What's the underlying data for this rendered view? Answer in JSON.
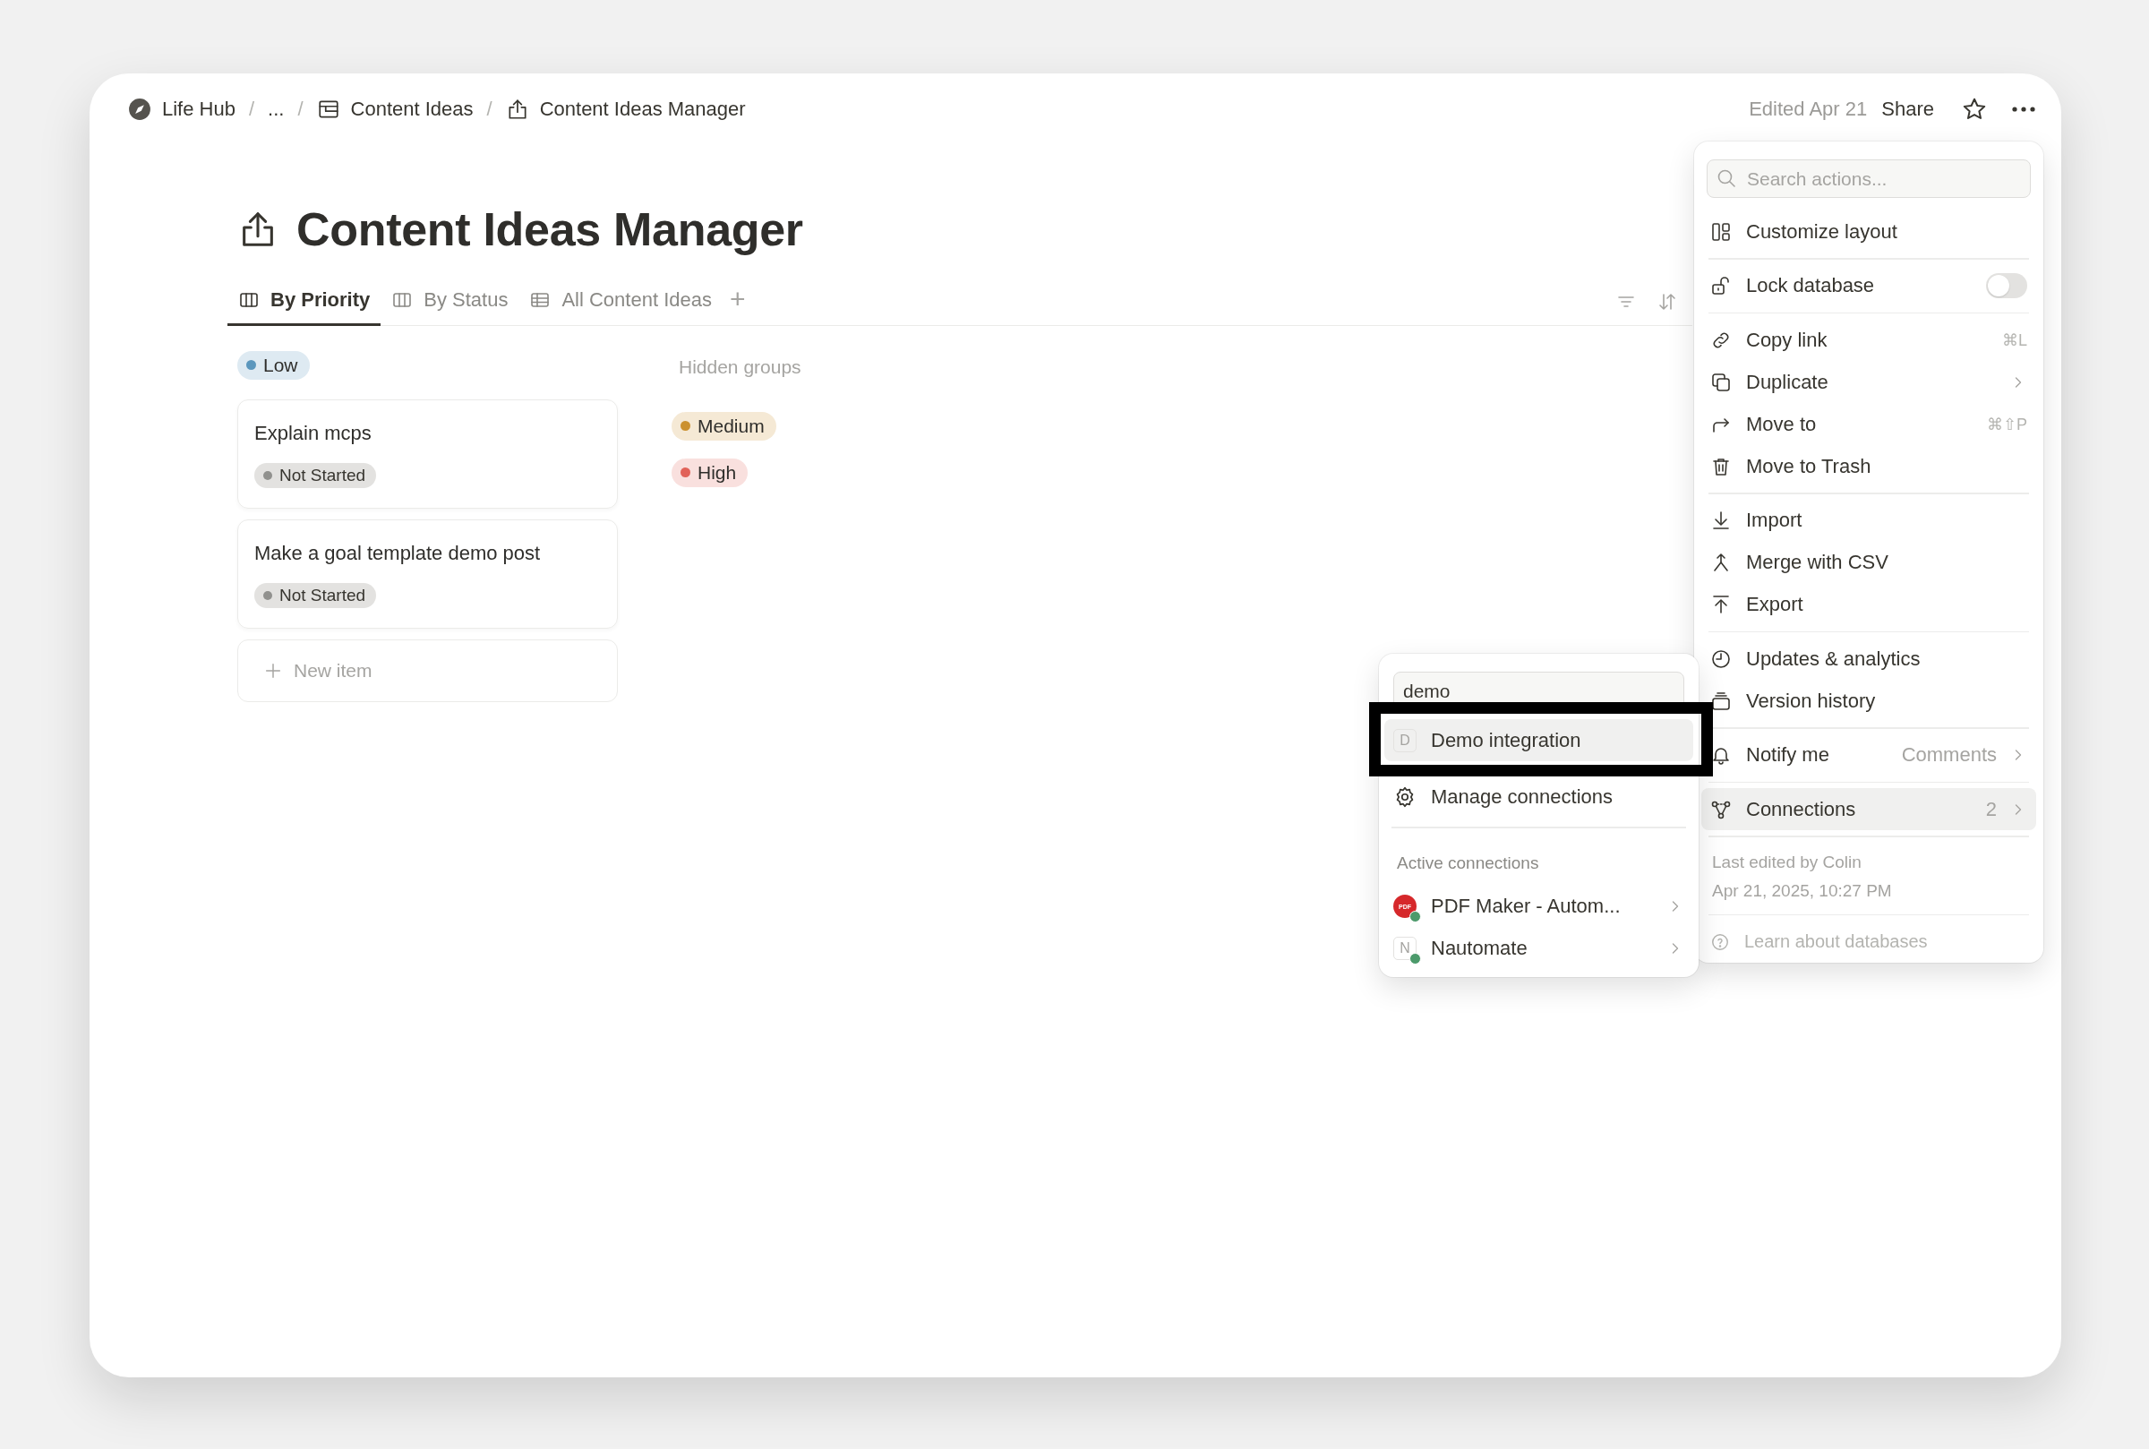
{
  "breadcrumb": {
    "separator": "/",
    "items": [
      {
        "label": "Life Hub",
        "kind": "workspace"
      },
      {
        "label": "...",
        "kind": "ellipsis"
      },
      {
        "label": "Content Ideas",
        "kind": "database"
      },
      {
        "label": "Content Ideas Manager",
        "kind": "page"
      }
    ]
  },
  "topbar": {
    "edited": "Edited Apr 21",
    "share": "Share"
  },
  "page": {
    "title": "Content Ideas Manager"
  },
  "tabs": [
    {
      "label": "By Priority",
      "kind": "board",
      "selected": true
    },
    {
      "label": "By Status",
      "kind": "board",
      "selected": false
    },
    {
      "label": "All Content Ideas",
      "kind": "table",
      "selected": false
    }
  ],
  "add_view": "+",
  "board": {
    "group": {
      "label": "Low",
      "color": "#5b97bd"
    },
    "cards": [
      {
        "title": "Explain mcps",
        "status": "Not Started"
      },
      {
        "title": "Make a goal template demo post",
        "status": "Not Started"
      }
    ],
    "new_item": "New item",
    "hidden_label": "Hidden groups",
    "hidden_groups": [
      {
        "label": "Medium",
        "color": "#cb912f"
      },
      {
        "label": "High",
        "color": "#e16259"
      }
    ]
  },
  "menu": {
    "search": {
      "placeholder": "Search actions..."
    },
    "sections": [
      [
        {
          "label": "Customize layout",
          "kind": "action",
          "selected": false
        }
      ],
      [
        {
          "label": "Lock database",
          "kind": "toggle",
          "on": false,
          "selected": false
        }
      ],
      [
        {
          "label": "Copy link",
          "kind": "action",
          "shortcut": "⌘L",
          "selected": false
        },
        {
          "label": "Duplicate",
          "kind": "submenu",
          "selected": false
        },
        {
          "label": "Move to",
          "kind": "action",
          "shortcut": "⌘⇧P",
          "selected": false
        },
        {
          "label": "Move to Trash",
          "kind": "action",
          "selected": false
        }
      ],
      [
        {
          "label": "Import",
          "kind": "action",
          "selected": false
        },
        {
          "label": "Merge with CSV",
          "kind": "action",
          "selected": false
        },
        {
          "label": "Export",
          "kind": "action",
          "selected": false
        }
      ],
      [
        {
          "label": "Updates & analytics",
          "kind": "action",
          "selected": false
        },
        {
          "label": "Version history",
          "kind": "action",
          "selected": false
        }
      ],
      [
        {
          "label": "Notify me",
          "kind": "submenu",
          "value": "Comments",
          "selected": false
        }
      ],
      [
        {
          "label": "Connections",
          "kind": "submenu",
          "count": "2",
          "selected": true
        }
      ]
    ],
    "last_edited": [
      "Last edited by Colin",
      "Apr 21, 2025, 10:27 PM"
    ],
    "help": "Learn about databases"
  },
  "connections_menu": {
    "search": {
      "value": "demo"
    },
    "results": [
      {
        "label": "Demo integration",
        "badge": "D",
        "selected": true,
        "outlined": true
      }
    ],
    "manage": {
      "label": "Manage connections",
      "selected": false
    },
    "heading": "Active connections",
    "connections": [
      {
        "label": "PDF Maker - Autom...",
        "kind": "logo",
        "logo": "PDF",
        "connected": true,
        "selected": false
      },
      {
        "label": "Nautomate",
        "kind": "letter",
        "badge": "N",
        "connected": true,
        "selected": false
      }
    ]
  }
}
